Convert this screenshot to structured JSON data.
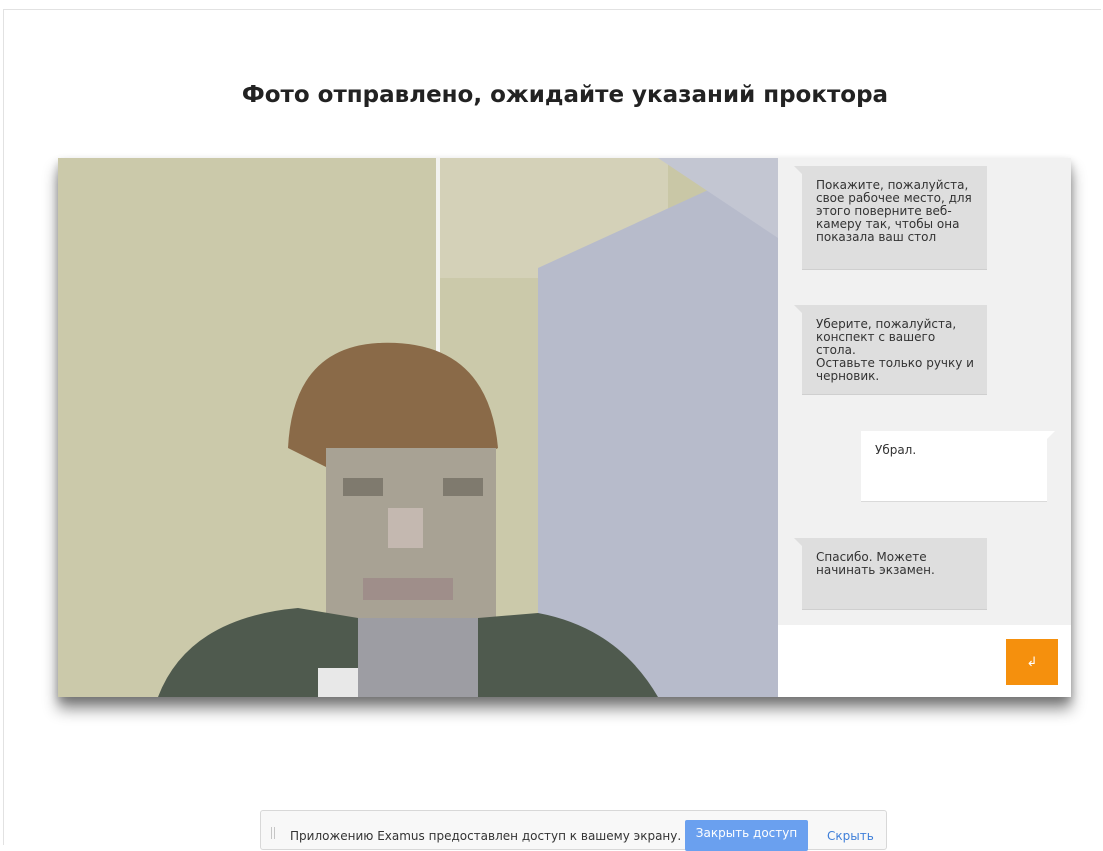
{
  "page": {
    "title": "Фото отправлено, ожидайте указаний проктора"
  },
  "chat": {
    "messages": [
      {
        "from": "proctor",
        "text": "Покажите, пожалуйста,\nсвое рабочее место, для\nэтого поверните веб-\nкамеру так, чтобы она\nпоказала ваш стол"
      },
      {
        "from": "proctor",
        "text": "Уберите, пожалуйста,\nконспект с вашего стола.\nОставьте только ручку и\nчерновик."
      },
      {
        "from": "student",
        "text": "Убрал."
      },
      {
        "from": "proctor",
        "text": "Спасибо. Можете\nначинать экзамен."
      }
    ],
    "input_value": "",
    "send_icon": "enter-icon",
    "send_glyph": "↲",
    "accent_color": "#f5900d"
  },
  "share_bar": {
    "text": "Приложению Examus предоставлен доступ к вашему экрану.",
    "close_label": "Закрыть доступ",
    "hide_label": "Скрыть"
  }
}
